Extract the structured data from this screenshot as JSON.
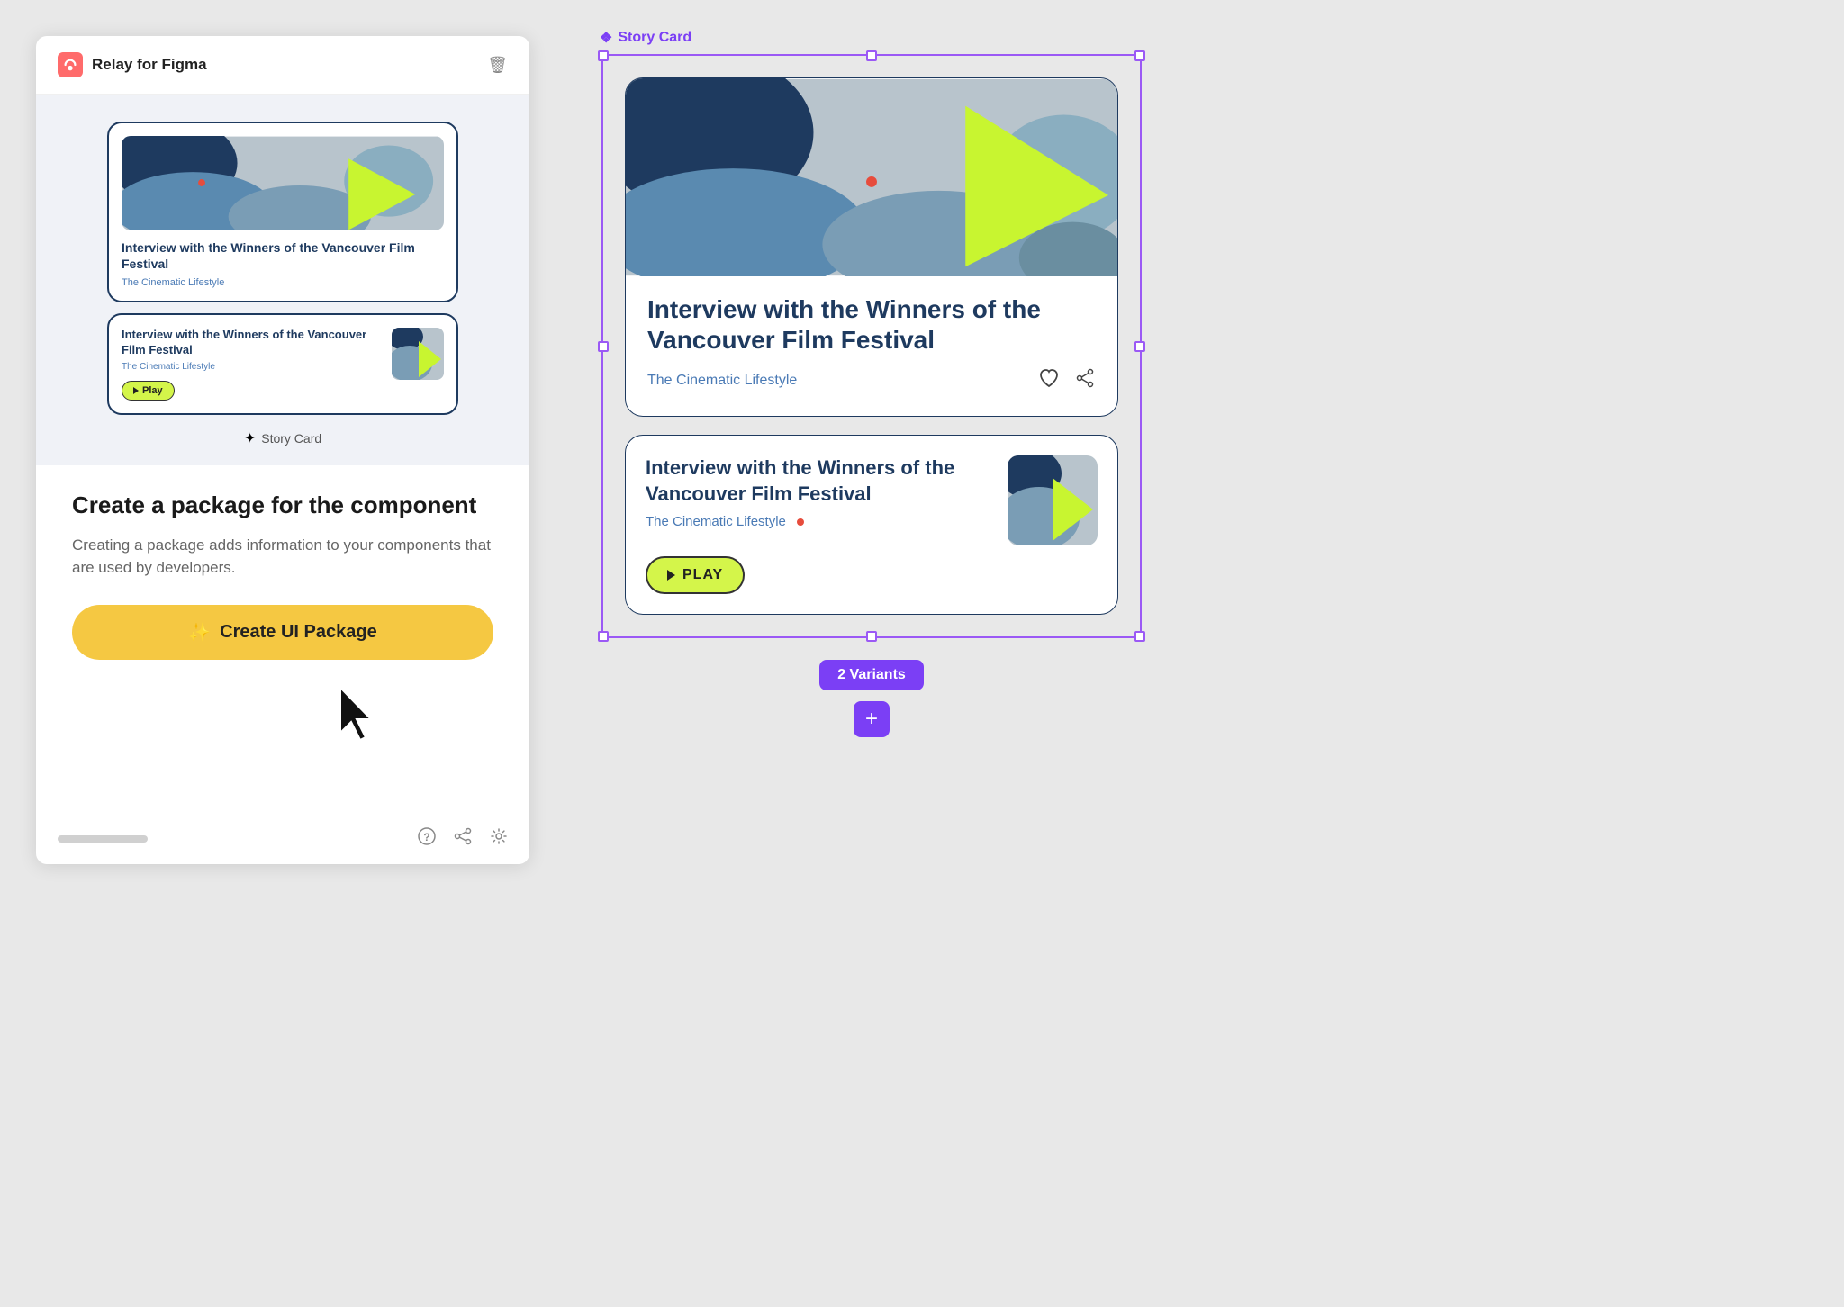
{
  "app": {
    "title": "Relay for Figma",
    "trash_label": "🗑"
  },
  "panel": {
    "component_label": "Story Card",
    "info_title": "Create a package for the component",
    "info_desc": "Creating a package adds information to your components that are used by developers.",
    "create_btn_label": "Create UI Package",
    "create_btn_icon": "✨"
  },
  "cards": {
    "title": "Interview with the Winners of the Vancouver Film Festival",
    "subtitle": "The Cinematic Lifestyle",
    "play_label": "Play",
    "play_label_large": "PLAY"
  },
  "frame": {
    "label": "Story Card",
    "sparkle": "❖",
    "variants_label": "2 Variants",
    "add_label": "+"
  },
  "footer": {
    "help_icon": "?",
    "share_icon": "share",
    "settings_icon": "⚙"
  }
}
